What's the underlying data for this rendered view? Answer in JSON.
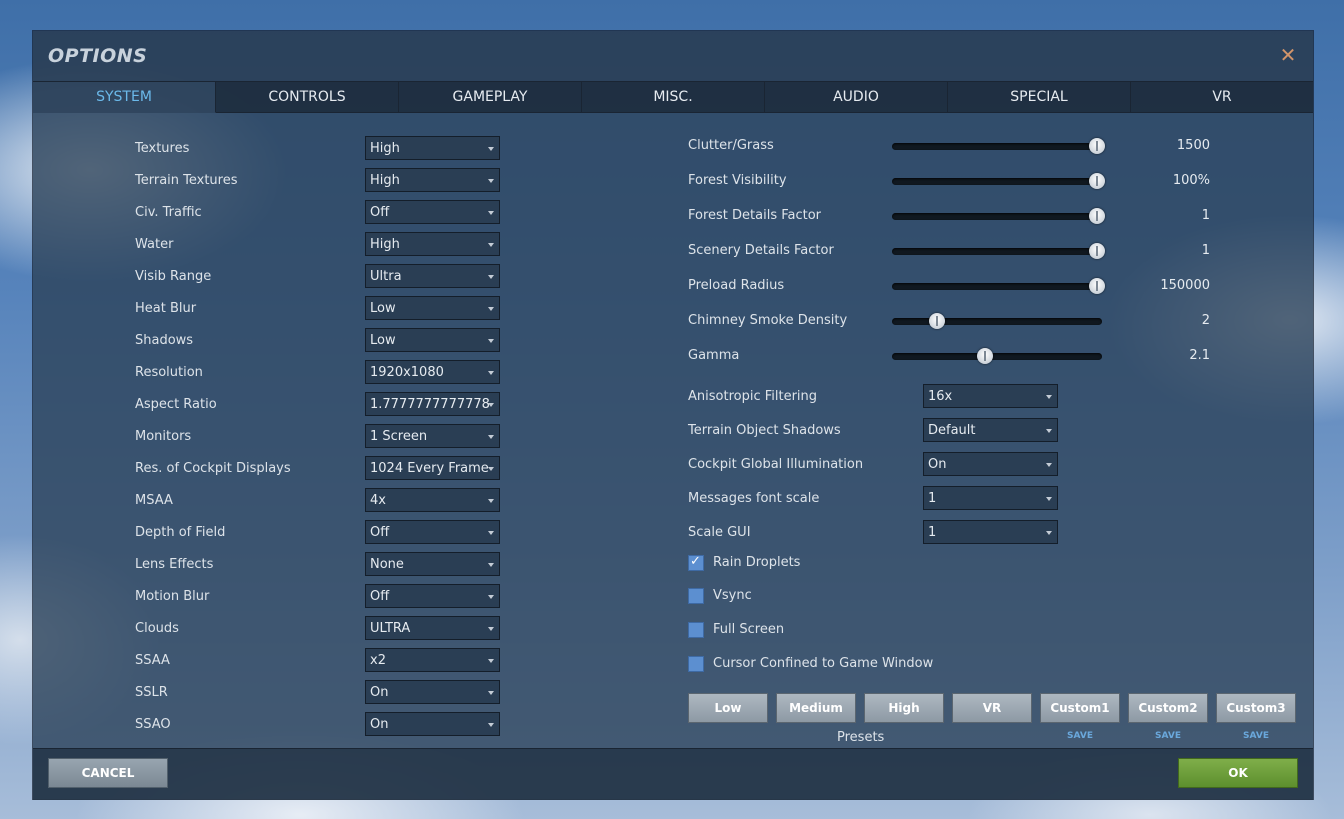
{
  "dialog": {
    "title": "OPTIONS",
    "close_icon": "close-icon"
  },
  "tabs": [
    "SYSTEM",
    "CONTROLS",
    "GAMEPLAY",
    "MISC.",
    "AUDIO",
    "SPECIAL",
    "VR"
  ],
  "active_tab": "SYSTEM",
  "left_settings": [
    {
      "label": "Textures",
      "value": "High"
    },
    {
      "label": "Terrain Textures",
      "value": "High"
    },
    {
      "label": "Civ. Traffic",
      "value": "Off"
    },
    {
      "label": "Water",
      "value": "High"
    },
    {
      "label": "Visib Range",
      "value": "Ultra"
    },
    {
      "label": "Heat Blur",
      "value": "Low"
    },
    {
      "label": "Shadows",
      "value": "Low"
    },
    {
      "label": "Resolution",
      "value": "1920x1080"
    },
    {
      "label": "Aspect Ratio",
      "value": "1.7777777777778"
    },
    {
      "label": "Monitors",
      "value": "1 Screen"
    },
    {
      "label": "Res. of Cockpit Displays",
      "value": "1024 Every Frame"
    },
    {
      "label": "MSAA",
      "value": "4x"
    },
    {
      "label": "Depth of Field",
      "value": "Off"
    },
    {
      "label": "Lens Effects",
      "value": "None"
    },
    {
      "label": "Motion Blur",
      "value": "Off"
    },
    {
      "label": "Clouds",
      "value": "ULTRA"
    },
    {
      "label": "SSAA",
      "value": "x2"
    },
    {
      "label": "SSLR",
      "value": "On"
    },
    {
      "label": "SSAO",
      "value": "On"
    }
  ],
  "sliders": [
    {
      "label": "Clutter/Grass",
      "value": "1500",
      "level": 1.0
    },
    {
      "label": "Forest Visibility",
      "value": "100%",
      "level": 1.0
    },
    {
      "label": "Forest Details Factor",
      "value": "1",
      "level": 1.0
    },
    {
      "label": "Scenery Details Factor",
      "value": "1",
      "level": 1.0
    },
    {
      "label": "Preload Radius",
      "value": "150000",
      "level": 1.0
    },
    {
      "label": "Chimney Smoke Density",
      "value": "2",
      "level": 0.2
    },
    {
      "label": "Gamma",
      "value": "2.1",
      "level": 0.44
    }
  ],
  "right_settings": [
    {
      "label": "Anisotropic Filtering",
      "value": "16x"
    },
    {
      "label": "Terrain Object Shadows",
      "value": "Default"
    },
    {
      "label": "Cockpit Global Illumination",
      "value": "On"
    },
    {
      "label": "Messages font scale",
      "value": "1"
    },
    {
      "label": "Scale GUI",
      "value": "1"
    }
  ],
  "checkboxes": [
    {
      "label": "Rain Droplets",
      "checked": true
    },
    {
      "label": "Vsync",
      "checked": false
    },
    {
      "label": "Full Screen",
      "checked": false
    },
    {
      "label": "Cursor Confined to Game Window",
      "checked": false
    }
  ],
  "presets": {
    "label": "Presets",
    "buttons": [
      "Low",
      "Medium",
      "High",
      "VR",
      "Custom1",
      "Custom2",
      "Custom3"
    ],
    "save_label": "SAVE"
  },
  "footer": {
    "cancel_label": "CANCEL",
    "ok_label": "OK"
  }
}
